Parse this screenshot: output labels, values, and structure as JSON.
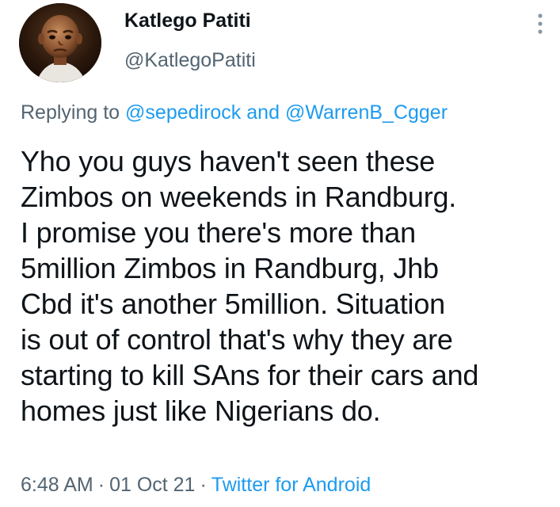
{
  "user": {
    "display_name": "Katlego Patiti",
    "handle": "@KatlegoPatiti",
    "avatar_icon": "profile-photo"
  },
  "reply": {
    "prefix": "Replying to",
    "mention_1": "@sepedirock",
    "conjunction": "and",
    "mention_2": "@WarrenB_Cgger"
  },
  "tweet": {
    "lines": [
      "Yho you guys haven't seen these",
      "Zimbos on weekends in Randburg.",
      "I promise you there's more than",
      "5million Zimbos in Randburg, Jhb",
      "Cbd it's another 5million. Situation",
      "is out of control that's why they are",
      "starting to kill SAns for their cars and",
      "homes just like Nigerians do."
    ]
  },
  "meta": {
    "time": "6:48 AM",
    "separator": "·",
    "date": "01 Oct 21",
    "source": "Twitter for Android"
  },
  "menu": {
    "icon": "more-vertical-icon"
  },
  "colors": {
    "text": "#0f1419",
    "secondary": "#536471",
    "accent": "#1d9bf0"
  }
}
